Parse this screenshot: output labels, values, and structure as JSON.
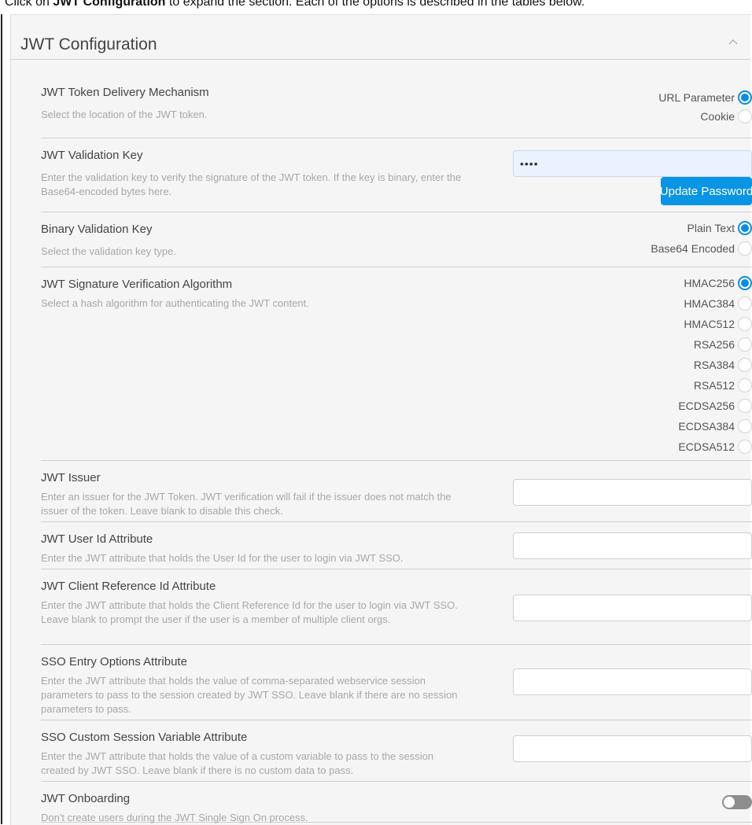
{
  "intro": {
    "prefix": "Click on ",
    "bold": "JWT Configuration",
    "suffix": " to expand the section. Each of the options is described in the tables below."
  },
  "panel": {
    "title": "JWT Configuration"
  },
  "delivery": {
    "label": "JWT Token Delivery Mechanism",
    "desc": "Select the location of the JWT token.",
    "options": [
      {
        "label": "URL Parameter",
        "selected": true
      },
      {
        "label": "Cookie",
        "selected": false
      }
    ]
  },
  "validation_key": {
    "label": "JWT Validation Key",
    "desc": "Enter the validation key to verify the signature of the JWT token. If the key is binary, enter the Base64-encoded bytes here.",
    "value": "••••",
    "button": "Update Password"
  },
  "binary_key": {
    "label": "Binary Validation Key",
    "desc": "Select the validation key type.",
    "options": [
      {
        "label": "Plain Text",
        "selected": true
      },
      {
        "label": "Base64 Encoded",
        "selected": false
      }
    ]
  },
  "algorithm": {
    "label": "JWT Signature Verification Algorithm",
    "desc": "Select a hash algorithm for authenticating the JWT content.",
    "options": [
      {
        "label": "HMAC256",
        "selected": true
      },
      {
        "label": "HMAC384",
        "selected": false
      },
      {
        "label": "HMAC512",
        "selected": false
      },
      {
        "label": "RSA256",
        "selected": false
      },
      {
        "label": "RSA384",
        "selected": false
      },
      {
        "label": "RSA512",
        "selected": false
      },
      {
        "label": "ECDSA256",
        "selected": false
      },
      {
        "label": "ECDSA384",
        "selected": false
      },
      {
        "label": "ECDSA512",
        "selected": false
      }
    ]
  },
  "issuer": {
    "label": "JWT Issuer",
    "desc": "Enter an issuer for the JWT Token. JWT verification will fail if the issuer does not match the issuer of the token. Leave blank to disable this check.",
    "value": ""
  },
  "user_id": {
    "label": "JWT User Id Attribute",
    "desc": "Enter the JWT attribute that holds the User Id for the user to login via JWT SSO.",
    "value": ""
  },
  "client_ref": {
    "label": "JWT Client Reference Id Attribute",
    "desc": "Enter the JWT attribute that holds the Client Reference Id for the user to login via JWT SSO. Leave blank to prompt the user if the user is a member of multiple client orgs.",
    "value": ""
  },
  "entry_options": {
    "label": "SSO Entry Options Attribute",
    "desc": "Enter the JWT attribute that holds the value of comma-separated webservice session parameters to pass to the session created by JWT SSO. Leave blank if there are no session parameters to pass.",
    "value": ""
  },
  "custom_var": {
    "label": "SSO Custom Session Variable Attribute",
    "desc": "Enter the JWT attribute that holds the value of a custom variable to pass to the session created by JWT SSO. Leave blank if there is no custom data to pass.",
    "value": ""
  },
  "onboarding": {
    "label": "JWT Onboarding",
    "desc": "Don't create users during the JWT Single Sign On process.",
    "enabled": false
  },
  "colors": {
    "accent": "#0a8de0",
    "button": "#0a94e4",
    "toggle_off": "#8e8e8e"
  }
}
